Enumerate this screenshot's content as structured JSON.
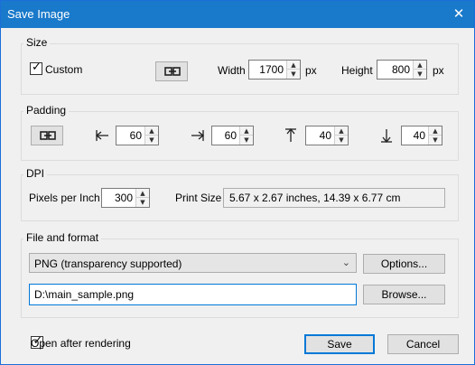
{
  "window": {
    "title": "Save Image",
    "close_glyph": "✕"
  },
  "size": {
    "group_label": "Size",
    "custom_label": "Custom",
    "custom_checked": true,
    "width_label": "Width",
    "width_value": "1700",
    "width_unit": "px",
    "height_label": "Height",
    "height_value": "800",
    "height_unit": "px",
    "link_icon": "link-icon"
  },
  "padding": {
    "group_label": "Padding",
    "link_icon": "link-icon",
    "left_value": "60",
    "right_value": "60",
    "top_value": "40",
    "bottom_value": "40",
    "left_icon": "arrow-left-bar-icon",
    "right_icon": "arrow-right-bar-icon",
    "top_icon": "arrow-up-bar-icon",
    "bottom_icon": "arrow-down-bar-icon"
  },
  "dpi": {
    "group_label": "DPI",
    "ppi_label": "Pixels per Inch",
    "ppi_value": "300",
    "print_size_label": "Print Size",
    "print_size_value": "5.67 x 2.67 inches, 14.39 x 6.77 cm"
  },
  "file": {
    "group_label": "File and format",
    "format_value": "PNG (transparency supported)",
    "options_label": "Options...",
    "path_value": "D:\\main_sample.png",
    "browse_label": "Browse..."
  },
  "footer": {
    "open_after_label": "Open after rendering",
    "open_after_checked": true,
    "save_label": "Save",
    "cancel_label": "Cancel"
  }
}
